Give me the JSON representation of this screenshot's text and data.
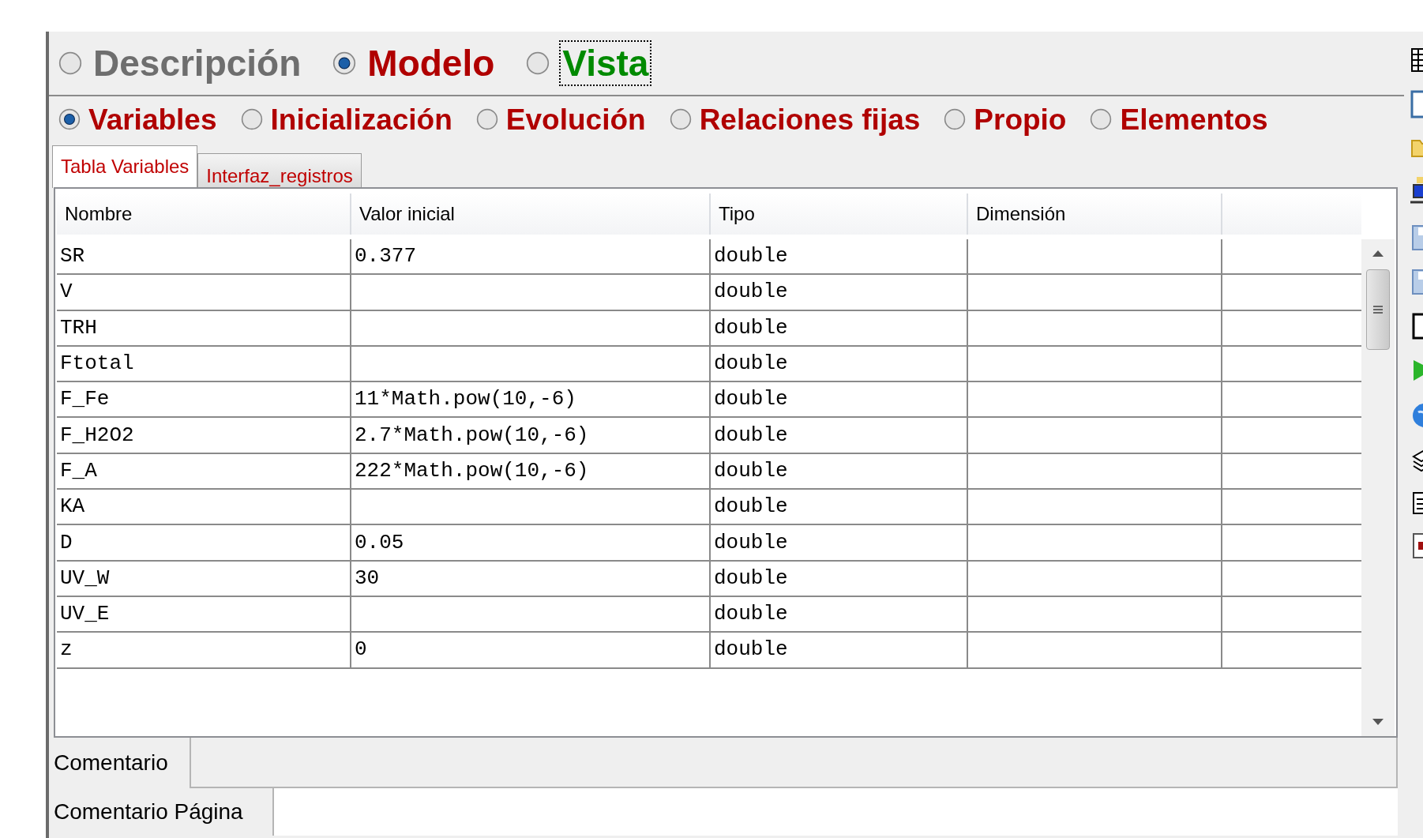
{
  "view_options": [
    {
      "label": "Descripción",
      "selected": false,
      "focused": false,
      "color": "#6e6e6e"
    },
    {
      "label": "Modelo",
      "selected": true,
      "focused": false,
      "color": "#b00000"
    },
    {
      "label": "Vista",
      "selected": false,
      "focused": true,
      "color": "#008a00"
    }
  ],
  "model_sections": [
    {
      "label": "Variables",
      "selected": true
    },
    {
      "label": "Inicialización",
      "selected": false
    },
    {
      "label": "Evolución",
      "selected": false
    },
    {
      "label": "Relaciones fijas",
      "selected": false
    },
    {
      "label": "Propio",
      "selected": false
    },
    {
      "label": "Elementos",
      "selected": false
    }
  ],
  "tabs": [
    {
      "label": "Tabla Variables",
      "selected": true
    },
    {
      "label": "Interfaz_registros",
      "selected": false
    }
  ],
  "table": {
    "columns": [
      "Nombre",
      "Valor inicial",
      "Tipo",
      "Dimensión"
    ],
    "rows": [
      {
        "name": "SR",
        "initial_value": "0.377",
        "type": "double"
      },
      {
        "name": "V",
        "type": "double"
      },
      {
        "name": "TRH",
        "type": "double"
      },
      {
        "name": "Ftotal",
        "type": "double"
      },
      {
        "name": "F_Fe",
        "initial_value": "11*Math.pow(10,-6)",
        "type": "double"
      },
      {
        "name": "F_H2O2",
        "initial_value": "2.7*Math.pow(10,-6)",
        "type": "double"
      },
      {
        "name": "F_A",
        "initial_value": "222*Math.pow(10,-6)",
        "type": "double"
      },
      {
        "name": "KA",
        "type": "double"
      },
      {
        "name": "D",
        "initial_value": "0.05",
        "type": "double"
      },
      {
        "name": "UV_W",
        "initial_value": "30",
        "type": "double"
      },
      {
        "name": "UV_E",
        "type": "double"
      },
      {
        "name": "z",
        "initial_value": "0",
        "type": "double"
      }
    ]
  },
  "comment": {
    "label": "Comentario"
  },
  "page_comment": {
    "label": "Comentario Página"
  }
}
